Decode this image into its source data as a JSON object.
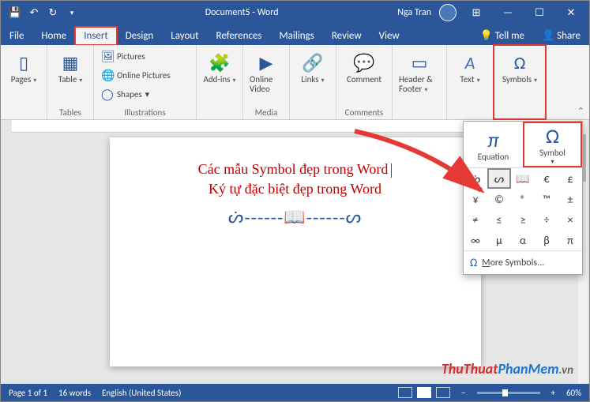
{
  "titlebar": {
    "doc_title": "Document5 - Word",
    "user": "Nga Tran"
  },
  "tabs": {
    "file": "File",
    "home": "Home",
    "insert": "Insert",
    "design": "Design",
    "layout": "Layout",
    "references": "References",
    "mailings": "Mailings",
    "review": "Review",
    "view": "View",
    "tellme": "Tell me",
    "share": "Share"
  },
  "ribbon": {
    "pages": {
      "btn": "Pages"
    },
    "tables": {
      "btn": "Table",
      "label": "Tables"
    },
    "illus": {
      "pictures": "Pictures",
      "online_pictures": "Online Pictures",
      "shapes": "Shapes",
      "label": "Illustrations"
    },
    "addins": {
      "btn": "Add-ins"
    },
    "media": {
      "btn": "Online Video",
      "label": "Media"
    },
    "links": {
      "btn": "Links"
    },
    "comments": {
      "btn": "Comment",
      "label": "Comments"
    },
    "headerfooter": {
      "btn": "Header & Footer"
    },
    "text": {
      "btn": "Text"
    },
    "symbols": {
      "btn": "Symbols"
    }
  },
  "document": {
    "line1": "Các mẫu Symbol đẹp trong Word",
    "line2": "Ký tự đặc biệt đẹp trong Word",
    "decoration": "ᔖ------📖------ᔕ"
  },
  "symbol_panel": {
    "equation": "Equation",
    "symbol": "Symbol",
    "grid": [
      "ᔖ",
      "ᔕ",
      "📖",
      "€",
      "£",
      "¥",
      "©",
      "®",
      "™",
      "±",
      "≠",
      "≤",
      "≥",
      "÷",
      "×",
      "∞",
      "μ",
      "α",
      "β",
      "π"
    ],
    "more": "More Symbols..."
  },
  "statusbar": {
    "page": "Page 1 of 1",
    "words": "16 words",
    "lang": "English (United States)",
    "zoom": "60%"
  },
  "watermark": {
    "a": "ThuThuat",
    "b": "PhanMem",
    "c": ".vn"
  }
}
